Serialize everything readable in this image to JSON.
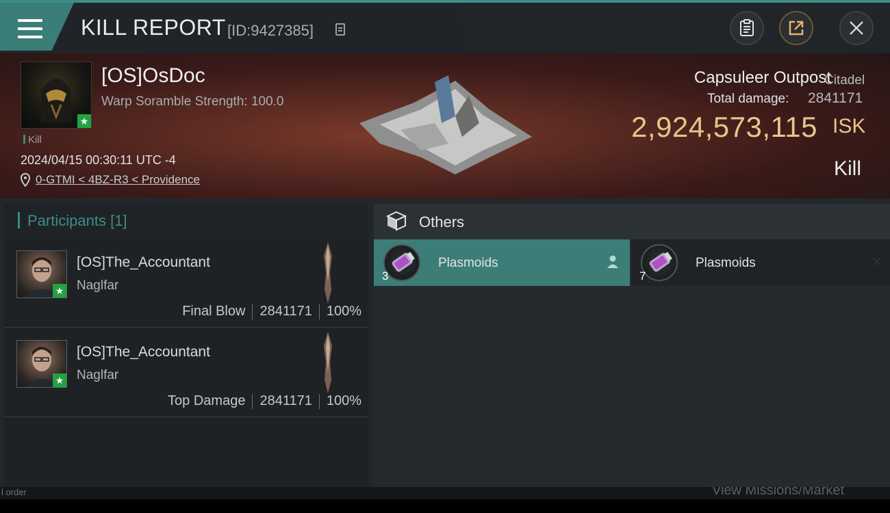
{
  "header": {
    "title": "KILL REPORT",
    "report_id": "[ID:9427385]"
  },
  "victim": {
    "name": "[OS]OsDoc",
    "status": "Warp Soramble Strength: 100.0",
    "tag": "Kill",
    "timestamp": "2024/04/15 00:30:11 UTC -4",
    "location": "0-GTMI < 4BZ-R3 < Providence"
  },
  "target": {
    "name": "Capsuleer Outpost",
    "class": "Citadel",
    "damage_label": "Total damage:",
    "damage_value": "2841171",
    "isk_value": "2,924,573,115",
    "isk_unit": "ISK",
    "outcome": "Kill"
  },
  "participants": {
    "label": "Participants",
    "count": "[1]",
    "rows": [
      {
        "name": "[OS]The_Accountant",
        "ship": "Naglfar",
        "role": "Final Blow",
        "damage": "2841171",
        "percent": "100%"
      },
      {
        "name": "[OS]The_Accountant",
        "ship": "Naglfar",
        "role": "Top Damage",
        "damage": "2841171",
        "percent": "100%"
      }
    ]
  },
  "others": {
    "label": "Others",
    "items": [
      {
        "name": "Plasmoids",
        "qty": "3"
      },
      {
        "name": "Plasmoids",
        "qty": "7"
      }
    ]
  },
  "footer": {
    "left": "l order",
    "right": "View Missions/Market"
  },
  "colors": {
    "accent": "#3b8d85",
    "isk": "#e9c48a",
    "badge": "#21a340"
  }
}
